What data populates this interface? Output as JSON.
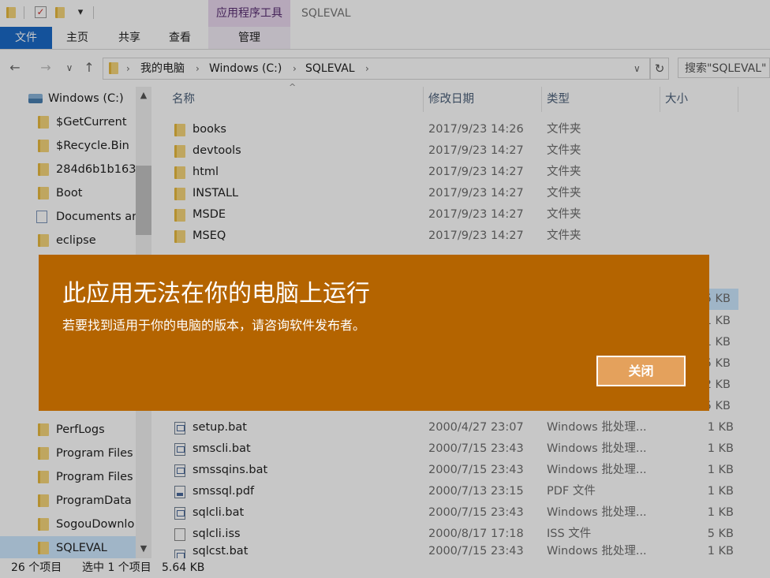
{
  "window": {
    "contextual_tab_header": "应用程序工具",
    "title": "SQLEVAL"
  },
  "quick_access": {
    "icons": [
      "folder-icon",
      "properties-icon",
      "new-folder-icon",
      "customize-dropdown-icon"
    ],
    "dropdown_glyph": "▾"
  },
  "ribbon": {
    "tabs": [
      {
        "label": "文件",
        "active": true
      },
      {
        "label": "主页"
      },
      {
        "label": "共享"
      },
      {
        "label": "查看"
      },
      {
        "label": "管理"
      }
    ]
  },
  "nav": {
    "back": "←",
    "forward": "→",
    "recent": "∨",
    "up": "↑",
    "breadcrumb": [
      "我的电脑",
      "Windows (C:)",
      "SQLEVAL"
    ],
    "breadcrumb_sep": "›",
    "dropdown": "∨",
    "refresh": "↻",
    "search_placeholder": "搜索\"SQLEVAL\""
  },
  "tree": {
    "items": [
      {
        "label": "Windows (C:)",
        "icon": "drive-icon"
      },
      {
        "label": "$GetCurrent",
        "icon": "folder-icon"
      },
      {
        "label": "$Recycle.Bin",
        "icon": "folder-icon"
      },
      {
        "label": "284d6b1b163",
        "icon": "folder-icon"
      },
      {
        "label": "Boot",
        "icon": "folder-icon"
      },
      {
        "label": "Documents ar",
        "icon": "shortcut-folder-icon"
      },
      {
        "label": "eclipse",
        "icon": "folder-icon"
      },
      {
        "label": "PerfLogs",
        "icon": "folder-icon"
      },
      {
        "label": "Program Files",
        "icon": "folder-icon"
      },
      {
        "label": "Program Files",
        "icon": "folder-icon"
      },
      {
        "label": "ProgramData",
        "icon": "folder-icon"
      },
      {
        "label": "SogouDownlo",
        "icon": "folder-icon"
      },
      {
        "label": "SQLEVAL",
        "icon": "folder-icon",
        "selected": true
      }
    ],
    "scroll_up": "▲",
    "scroll_down": "▼"
  },
  "columns": {
    "name": "名称",
    "modified": "修改日期",
    "type": "类型",
    "size": "大小",
    "sort_indicator": "^"
  },
  "files_top": [
    {
      "name": "books",
      "modified": "2017/9/23 14:26",
      "type": "文件夹",
      "size": "",
      "icon": "folder-icon"
    },
    {
      "name": "devtools",
      "modified": "2017/9/23 14:27",
      "type": "文件夹",
      "size": "",
      "icon": "folder-icon"
    },
    {
      "name": "html",
      "modified": "2017/9/23 14:27",
      "type": "文件夹",
      "size": "",
      "icon": "folder-icon"
    },
    {
      "name": "INSTALL",
      "modified": "2017/9/23 14:27",
      "type": "文件夹",
      "size": "",
      "icon": "folder-icon"
    },
    {
      "name": "MSDE",
      "modified": "2017/9/23 14:27",
      "type": "文件夹",
      "size": "",
      "icon": "folder-icon"
    },
    {
      "name": "MSEQ",
      "modified": "2017/9/23 14:27",
      "type": "文件夹",
      "size": "",
      "icon": "folder-icon"
    }
  ],
  "hidden_sizes": [
    "5 KB",
    "1 KB",
    "1 KB",
    "5 KB",
    "2 KB",
    "5 KB"
  ],
  "files_bottom": [
    {
      "name": "setup.bat",
      "modified": "2000/4/27 23:07",
      "type": "Windows 批处理...",
      "size": "1 KB",
      "icon": "batch-file-icon"
    },
    {
      "name": "smscli.bat",
      "modified": "2000/7/15 23:43",
      "type": "Windows 批处理...",
      "size": "1 KB",
      "icon": "batch-file-icon"
    },
    {
      "name": "smssqins.bat",
      "modified": "2000/7/15 23:43",
      "type": "Windows 批处理...",
      "size": "1 KB",
      "icon": "batch-file-icon"
    },
    {
      "name": "smssql.pdf",
      "modified": "2000/7/13 23:15",
      "type": "PDF 文件",
      "size": "1 KB",
      "icon": "pdf-file-icon"
    },
    {
      "name": "sqlcli.bat",
      "modified": "2000/7/15 23:43",
      "type": "Windows 批处理...",
      "size": "1 KB",
      "icon": "batch-file-icon"
    },
    {
      "name": "sqlcli.iss",
      "modified": "2000/8/17 17:18",
      "type": "ISS 文件",
      "size": "5 KB",
      "icon": "generic-file-icon"
    },
    {
      "name": "sqlcst.bat",
      "modified": "2000/7/15 23:43",
      "type": "Windows 批处理...",
      "size": "1 KB",
      "icon": "batch-file-icon"
    }
  ],
  "status": {
    "count": "26 个项目",
    "selection": "选中 1 个项目",
    "selection_size": "5.64 KB"
  },
  "dialog": {
    "title": "此应用无法在你的电脑上运行",
    "message": "若要找到适用于你的电脑的版本，请咨询软件发布者。",
    "close_label": "关闭",
    "bg_color": "#b46400",
    "button_color": "#e4a15c"
  }
}
